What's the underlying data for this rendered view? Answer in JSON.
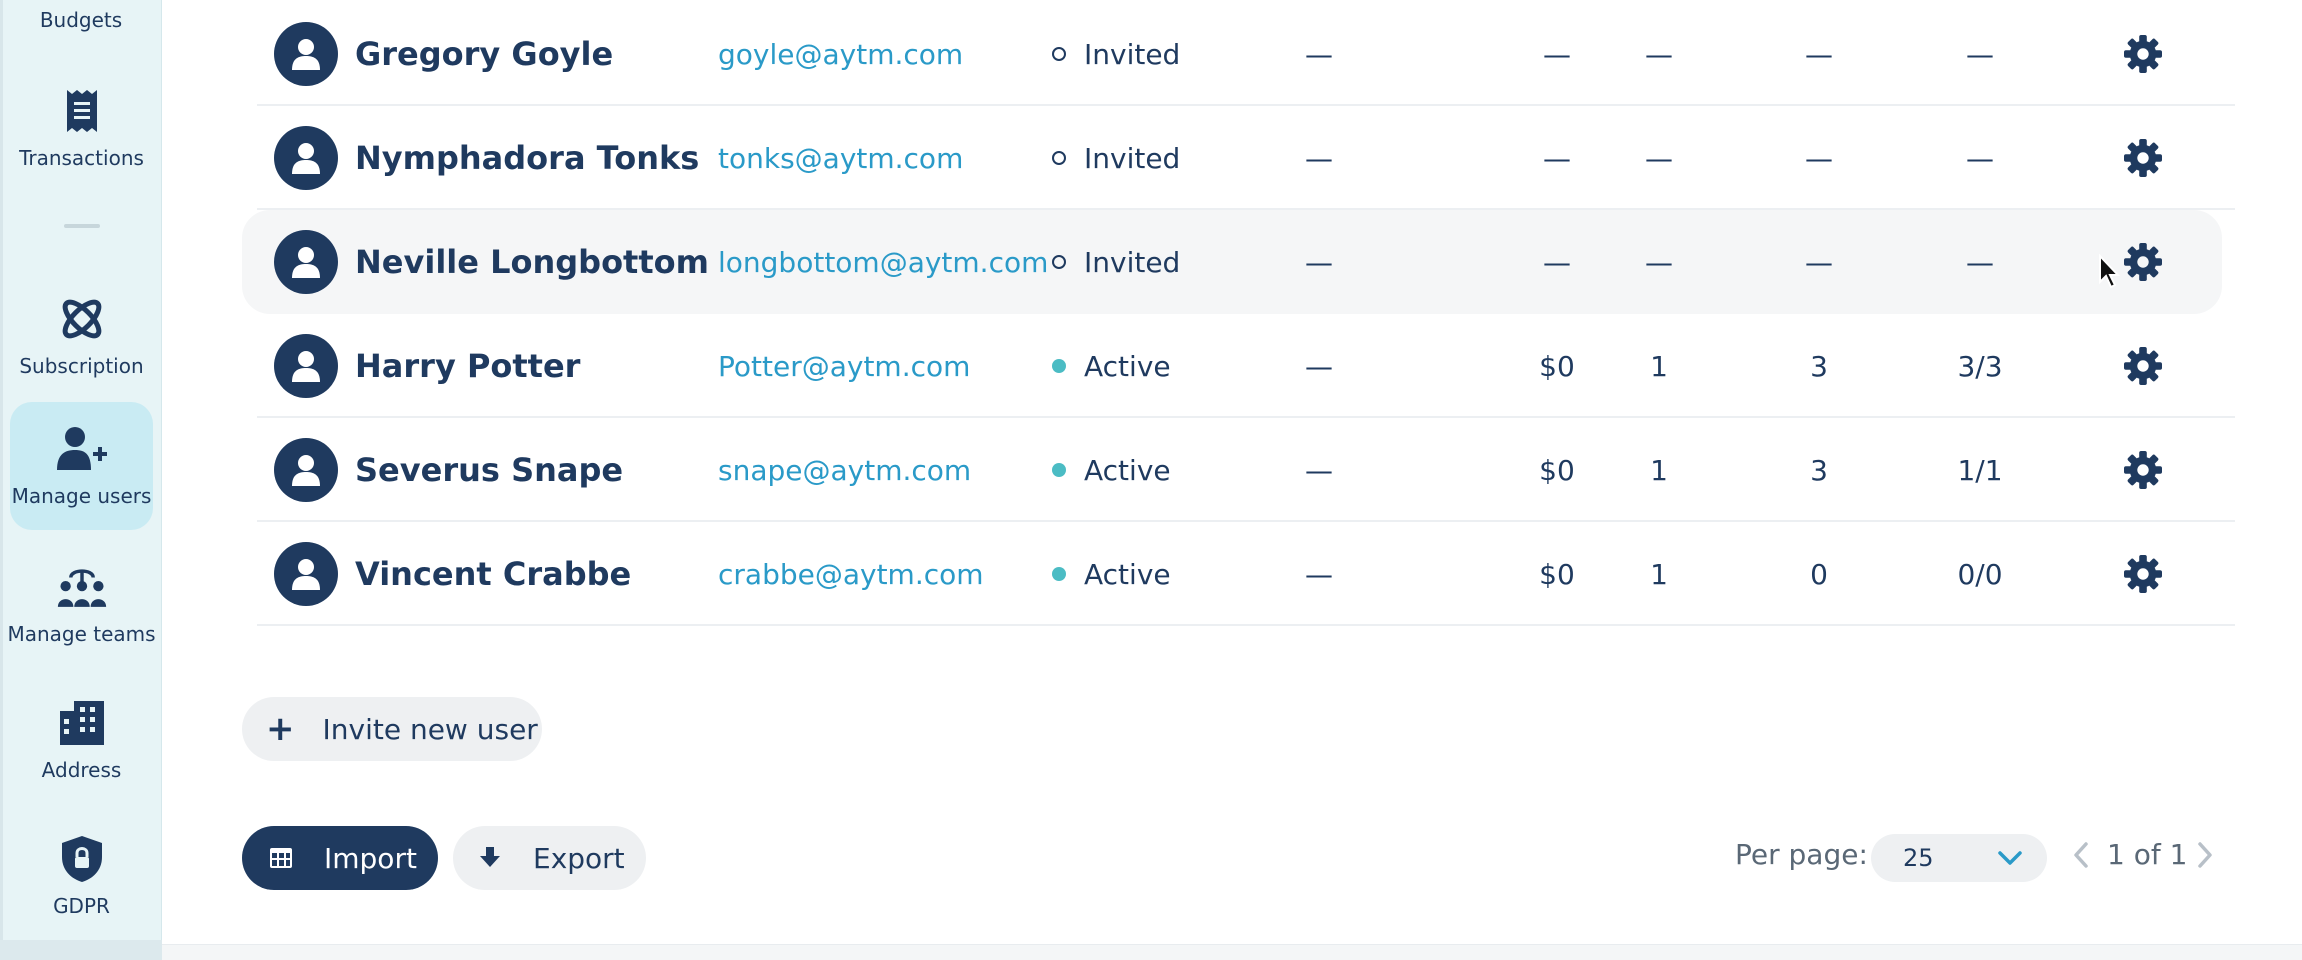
{
  "sidebar": {
    "top_label": "Budgets",
    "items": [
      {
        "label": "Transactions",
        "icon": "receipt-icon"
      },
      {
        "label": "Subscription",
        "icon": "atom-icon"
      },
      {
        "label": "Manage users",
        "icon": "user-plus-icon",
        "active": true
      },
      {
        "label": "Manage teams",
        "icon": "team-icon"
      },
      {
        "label": "Address",
        "icon": "building-icon"
      },
      {
        "label": "GDPR",
        "icon": "shield-lock-icon"
      }
    ]
  },
  "users": [
    {
      "name": "Gregory Goyle",
      "email": "goyle@aytm.com",
      "status": "Invited",
      "c1": "—",
      "c2": "—",
      "c3": "—",
      "c4": "—",
      "c5": "—"
    },
    {
      "name": "Nymphadora Tonks",
      "email": "tonks@aytm.com",
      "status": "Invited",
      "c1": "—",
      "c2": "—",
      "c3": "—",
      "c4": "—",
      "c5": "—"
    },
    {
      "name": "Neville Longbottom",
      "email": "longbottom@aytm.com",
      "status": "Invited",
      "c1": "—",
      "c2": "—",
      "c3": "—",
      "c4": "—",
      "c5": "—"
    },
    {
      "name": "Harry Potter",
      "email": "Potter@aytm.com",
      "status": "Active",
      "c1": "—",
      "c2": "$0",
      "c3": "1",
      "c4": "3",
      "c5": "3/3"
    },
    {
      "name": "Severus Snape",
      "email": "snape@aytm.com",
      "status": "Active",
      "c1": "—",
      "c2": "$0",
      "c3": "1",
      "c4": "3",
      "c5": "1/1"
    },
    {
      "name": "Vincent Crabbe",
      "email": "crabbe@aytm.com",
      "status": "Active",
      "c1": "—",
      "c2": "$0",
      "c3": "1",
      "c4": "0",
      "c5": "0/0"
    }
  ],
  "actions": {
    "invite_label": "Invite new user",
    "import_label": "Import",
    "export_label": "Export"
  },
  "pagination": {
    "per_page_label": "Per page:",
    "per_page_value": "25",
    "page_text": "1 of 1"
  },
  "colors": {
    "primary": "#1f3a5f",
    "link": "#2a9ac8",
    "active_dot": "#4bbcc4",
    "sidebar_bg": "#e7f4f6",
    "sidebar_active": "#c9ebf3"
  }
}
